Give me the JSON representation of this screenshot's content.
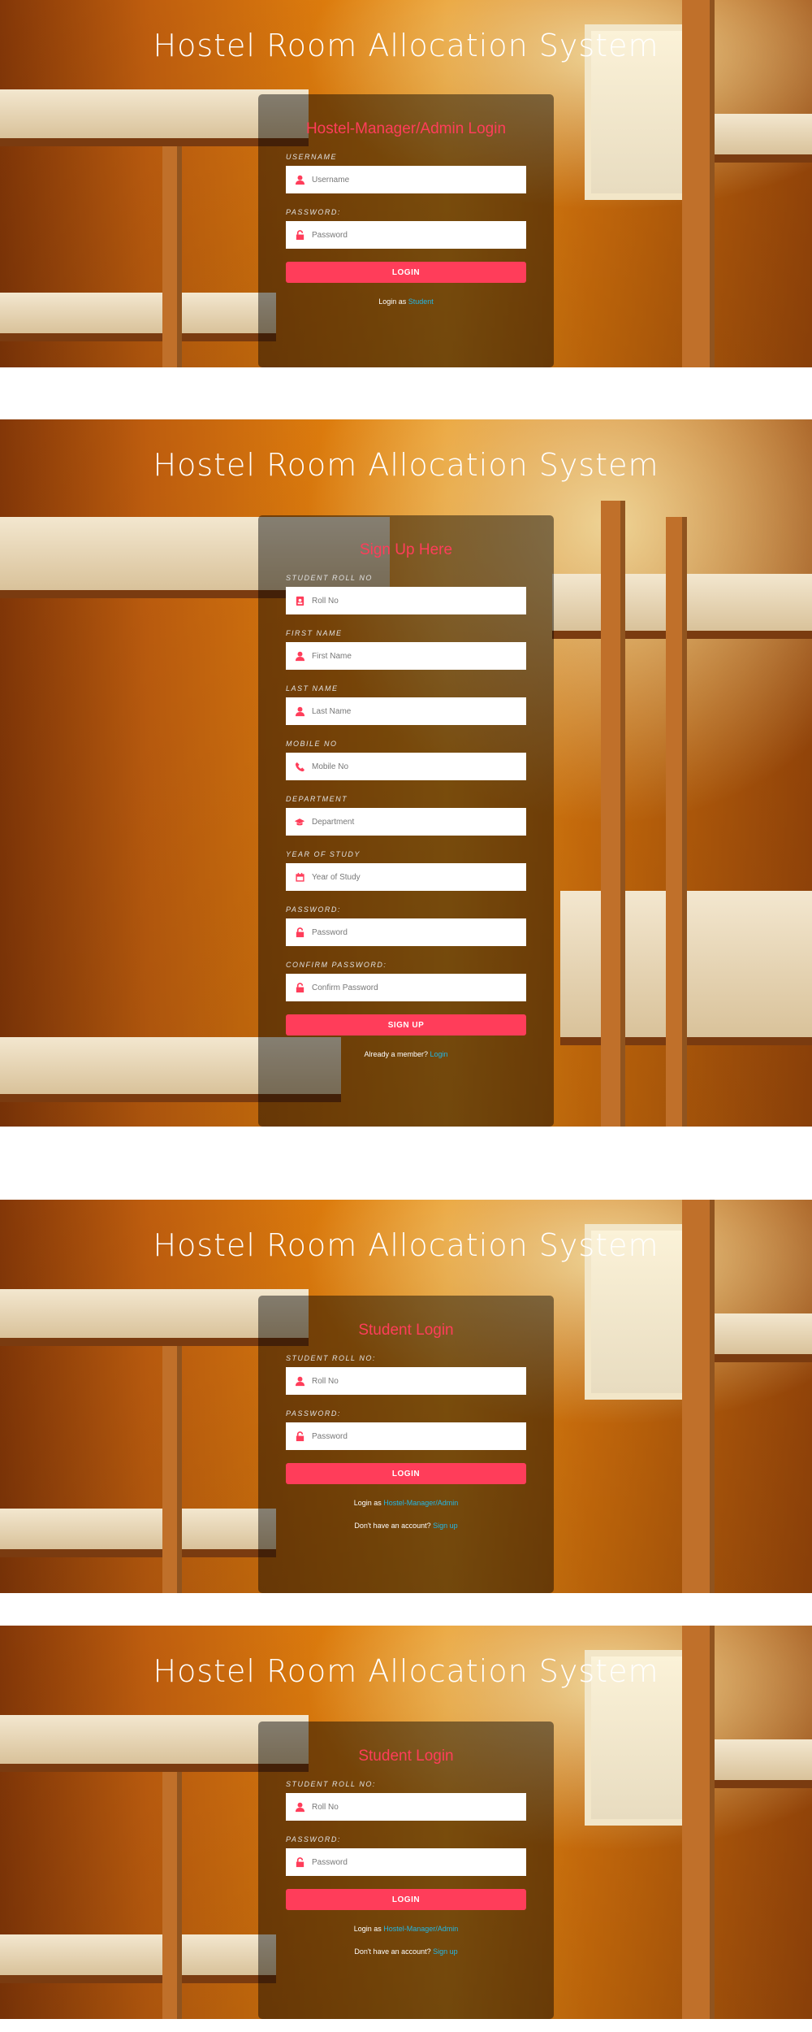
{
  "app": {
    "title": "Hostel Room Allocation System"
  },
  "colors": {
    "accent": "#ff3d5a",
    "link": "#23b7e5"
  },
  "admin_login": {
    "heading": "Hostel-Manager/Admin Login",
    "username_label": "USERNAME",
    "username_placeholder": "Username",
    "password_label": "PASSWORD:",
    "password_placeholder": "Password",
    "button": "LOGIN",
    "footer_prefix": "Login as",
    "footer_link": "Student"
  },
  "signup": {
    "heading": "Sign Up Here",
    "fields": [
      {
        "label": "STUDENT ROLL NO",
        "placeholder": "Roll No",
        "icon": "id-card-icon"
      },
      {
        "label": "FIRST NAME",
        "placeholder": "First Name",
        "icon": "user-icon"
      },
      {
        "label": "LAST NAME",
        "placeholder": "Last Name",
        "icon": "user-icon"
      },
      {
        "label": "MOBILE NO",
        "placeholder": "Mobile No",
        "icon": "phone-icon"
      },
      {
        "label": "DEPARTMENT",
        "placeholder": "Department",
        "icon": "graduation-cap-icon"
      },
      {
        "label": "YEAR OF STUDY",
        "placeholder": "Year of Study",
        "icon": "calendar-icon"
      },
      {
        "label": "PASSWORD:",
        "placeholder": "Password",
        "icon": "lock-icon"
      },
      {
        "label": "CONFIRM PASSWORD:",
        "placeholder": "Confirm Password",
        "icon": "lock-icon"
      }
    ],
    "button": "SIGN UP",
    "footer_prefix": "Already a member?",
    "footer_link": "Login"
  },
  "student_login": {
    "heading": "Student Login",
    "rollno_label": "STUDENT ROLL NO:",
    "rollno_placeholder": "Roll No",
    "password_label": "PASSWORD:",
    "password_placeholder": "Password",
    "button": "LOGIN",
    "footer1_prefix": "Login as",
    "footer1_link": "Hostel-Manager/Admin",
    "footer2_prefix": "Don't have an account?",
    "footer2_link": "Sign up"
  }
}
